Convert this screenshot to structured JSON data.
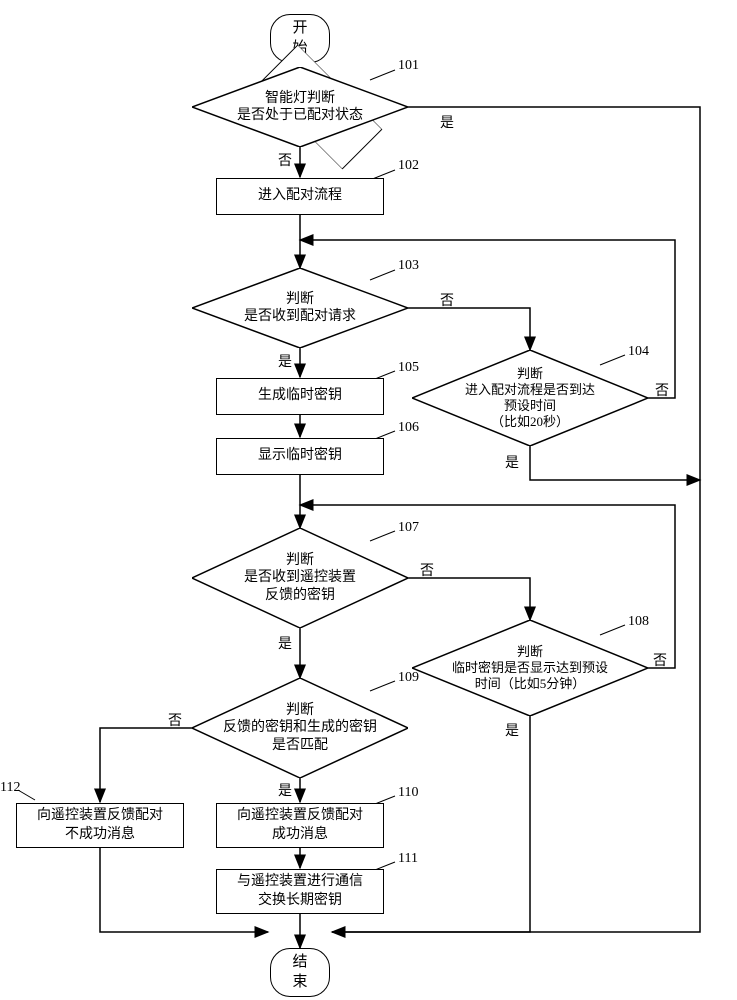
{
  "nodes": {
    "start": "开始",
    "end": "结束",
    "d101_l1": "智能灯判断",
    "d101_l2": "是否处于已配对状态",
    "r102": "进入配对流程",
    "d103_l1": "判断",
    "d103_l2": "是否收到配对请求",
    "d104_l1": "判断",
    "d104_l2": "进入配对流程是否到达",
    "d104_l3": "预设时间",
    "d104_l4": "（比如20秒）",
    "r105": "生成临时密钥",
    "r106": "显示临时密钥",
    "d107_l1": "判断",
    "d107_l2": "是否收到遥控装置",
    "d107_l3": "反馈的密钥",
    "d108_l1": "判断",
    "d108_l2": "临时密钥是否显示达到预设",
    "d108_l3": "时间（比如5分钟）",
    "d109_l1": "判断",
    "d109_l2": "反馈的密钥和生成的密钥",
    "d109_l3": "是否匹配",
    "r110_l1": "向遥控装置反馈配对",
    "r110_l2": "成功消息",
    "r111_l1": "与遥控装置进行通信",
    "r111_l2": "交换长期密钥",
    "r112_l1": "向遥控装置反馈配对",
    "r112_l2": "不成功消息"
  },
  "step_nums": {
    "n101": "101",
    "n102": "102",
    "n103": "103",
    "n104": "104",
    "n105": "105",
    "n106": "106",
    "n107": "107",
    "n108": "108",
    "n109": "109",
    "n110": "110",
    "n111": "111",
    "n112": "112"
  },
  "edge_labels": {
    "yes": "是",
    "no": "否"
  }
}
